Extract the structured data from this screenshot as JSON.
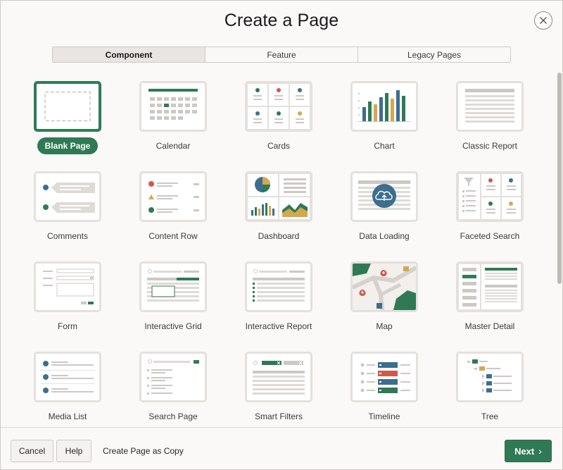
{
  "dialog": {
    "title": "Create a Page"
  },
  "tabs": [
    {
      "label": "Component",
      "active": true
    },
    {
      "label": "Feature",
      "active": false
    },
    {
      "label": "Legacy Pages",
      "active": false
    }
  ],
  "tiles": [
    {
      "label": "Blank Page",
      "icon": "blank-page-icon",
      "selected": true
    },
    {
      "label": "Calendar",
      "icon": "calendar-icon",
      "selected": false
    },
    {
      "label": "Cards",
      "icon": "cards-icon",
      "selected": false
    },
    {
      "label": "Chart",
      "icon": "chart-icon",
      "selected": false
    },
    {
      "label": "Classic Report",
      "icon": "classic-report-icon",
      "selected": false
    },
    {
      "label": "Comments",
      "icon": "comments-icon",
      "selected": false
    },
    {
      "label": "Content Row",
      "icon": "content-row-icon",
      "selected": false
    },
    {
      "label": "Dashboard",
      "icon": "dashboard-icon",
      "selected": false
    },
    {
      "label": "Data Loading",
      "icon": "data-loading-icon",
      "selected": false
    },
    {
      "label": "Faceted Search",
      "icon": "faceted-search-icon",
      "selected": false
    },
    {
      "label": "Form",
      "icon": "form-icon",
      "selected": false
    },
    {
      "label": "Interactive Grid",
      "icon": "interactive-grid-icon",
      "selected": false
    },
    {
      "label": "Interactive Report",
      "icon": "interactive-report-icon",
      "selected": false
    },
    {
      "label": "Map",
      "icon": "map-icon",
      "selected": false
    },
    {
      "label": "Master Detail",
      "icon": "master-detail-icon",
      "selected": false
    },
    {
      "label": "Media List",
      "icon": "media-list-icon",
      "selected": false
    },
    {
      "label": "Search Page",
      "icon": "search-page-icon",
      "selected": false
    },
    {
      "label": "Smart Filters",
      "icon": "smart-filters-icon",
      "selected": false
    },
    {
      "label": "Timeline",
      "icon": "timeline-icon",
      "selected": false
    },
    {
      "label": "Tree",
      "icon": "tree-icon",
      "selected": false
    }
  ],
  "footer": {
    "cancel_label": "Cancel",
    "help_label": "Help",
    "copy_label": "Create Page as Copy",
    "next_label": "Next"
  },
  "colors": {
    "accent_green": "#2f7a55",
    "red": "#d0594d",
    "blue": "#3c6e8f",
    "gold": "#d5a74e",
    "gray": "#cdc8c3"
  }
}
